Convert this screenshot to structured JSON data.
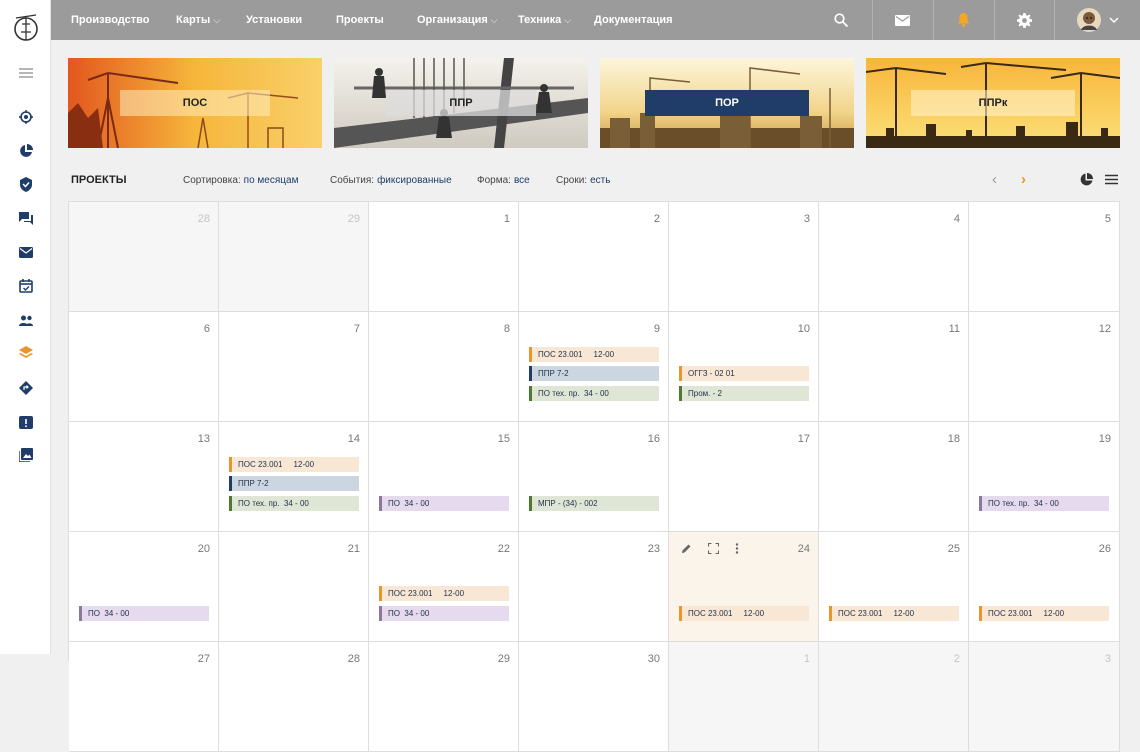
{
  "nav": {
    "items": [
      {
        "label": "Производство",
        "chevron": false
      },
      {
        "label": "Карты",
        "chevron": true
      },
      {
        "label": "Установки",
        "chevron": false
      },
      {
        "label": "Проекты",
        "chevron": false
      },
      {
        "label": "Организация",
        "chevron": true
      },
      {
        "label": "Техника",
        "chevron": true
      },
      {
        "label": "Документация",
        "chevron": false
      }
    ],
    "chevron_glyph": "⌵"
  },
  "top_icons": [
    "search-icon",
    "mail-icon",
    "bell-icon",
    "gear-icon",
    "avatar"
  ],
  "colors": {
    "accent": "#f5a623",
    "navy": "#1f3d68",
    "topbar": "#9b9b9b",
    "orange_event": "#e8962c",
    "green_event": "#4c7a2e",
    "purple_event": "#8a7a9a"
  },
  "banners": [
    {
      "label": "ПОС",
      "active": false
    },
    {
      "label": "ППР",
      "active": false
    },
    {
      "label": "ПОР",
      "active": true
    },
    {
      "label": "ППРк",
      "active": false
    }
  ],
  "toolbar": {
    "title": "ПРОЕКТЫ",
    "filters": [
      {
        "label": "Сортировка:",
        "value": "по месяцам"
      },
      {
        "label": "События:",
        "value": "фиксированные"
      },
      {
        "label": "Форма:",
        "value": "все"
      },
      {
        "label": "Сроки:",
        "value": "есть"
      }
    ],
    "prev": "‹",
    "next": "›"
  },
  "calendar": {
    "weeks": [
      [
        {
          "day": "28",
          "muted": true
        },
        {
          "day": "29",
          "muted": true
        },
        {
          "day": "1"
        },
        {
          "day": "2"
        },
        {
          "day": "3"
        },
        {
          "day": "4"
        },
        {
          "day": "5"
        }
      ],
      [
        {
          "day": "6"
        },
        {
          "day": "7"
        },
        {
          "day": "8"
        },
        {
          "day": "9",
          "events": [
            {
              "text": "ПОС 23.001     12-00",
              "color": "orange"
            },
            {
              "text": "ППР 7-2",
              "color": "navy"
            },
            {
              "text": "ПО тех. пр.  34 - 00",
              "color": "green"
            }
          ]
        },
        {
          "day": "10",
          "events": [
            {
              "text": "ОГГЗ - 02 01",
              "color": "orange"
            },
            {
              "text": "Пром. - 2",
              "color": "green"
            }
          ]
        },
        {
          "day": "11"
        },
        {
          "day": "12"
        }
      ],
      [
        {
          "day": "13"
        },
        {
          "day": "14",
          "events": [
            {
              "text": "ПОС 23.001     12-00",
              "color": "orange"
            },
            {
              "text": "ППР 7-2",
              "color": "navy"
            },
            {
              "text": "ПО тех. пр.  34 - 00",
              "color": "green"
            }
          ]
        },
        {
          "day": "15",
          "events": [
            {
              "text": "ПО  34 - 00",
              "color": "purple"
            }
          ]
        },
        {
          "day": "16",
          "events": [
            {
              "text": "МПР - (34) - 002",
              "color": "green"
            }
          ]
        },
        {
          "day": "17"
        },
        {
          "day": "18"
        },
        {
          "day": "19",
          "events": [
            {
              "text": "ПО тех. пр.  34 - 00",
              "color": "purple"
            }
          ]
        }
      ],
      [
        {
          "day": "20",
          "events": [
            {
              "text": "ПО  34 - 00",
              "color": "purple"
            }
          ]
        },
        {
          "day": "21"
        },
        {
          "day": "22",
          "events": [
            {
              "text": "ПОС 23.001     12-00",
              "color": "orange"
            },
            {
              "text": "ПО  34 - 00",
              "color": "purple"
            }
          ]
        },
        {
          "day": "23"
        },
        {
          "day": "24",
          "today": true,
          "events": [
            {
              "text": "ПОС 23.001     12-00",
              "color": "orange"
            }
          ]
        },
        {
          "day": "25",
          "events": [
            {
              "text": "ПОС 23.001     12-00",
              "color": "orange"
            }
          ]
        },
        {
          "day": "26",
          "events": [
            {
              "text": "ПОС 23.001     12-00",
              "color": "orange"
            }
          ]
        }
      ],
      [
        {
          "day": "27"
        },
        {
          "day": "28"
        },
        {
          "day": "29"
        },
        {
          "day": "30"
        },
        {
          "day": "1",
          "muted": true
        },
        {
          "day": "2",
          "muted": true
        },
        {
          "day": "3",
          "muted": true
        }
      ]
    ]
  }
}
